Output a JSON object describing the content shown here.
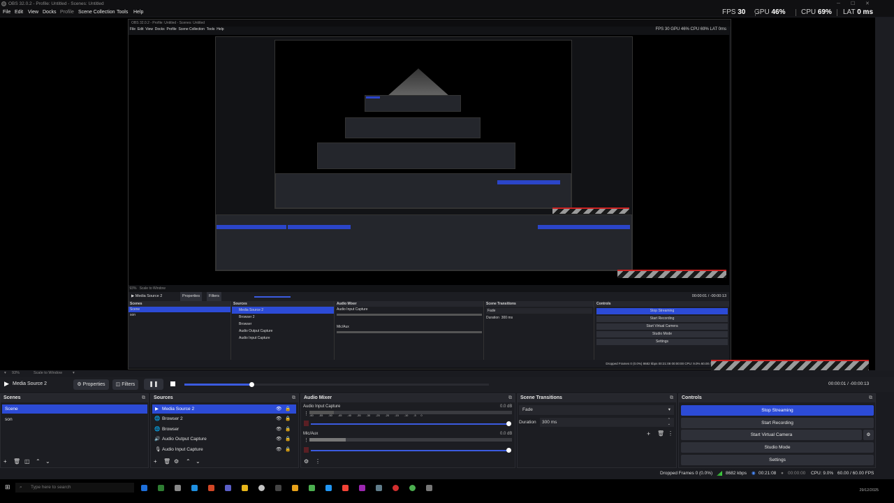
{
  "window": {
    "title": "OBS 32.0.2 - Profile: Untitled - Scenes: Untitled",
    "min": "─",
    "max": "☐",
    "close": "✕"
  },
  "menu": [
    "File",
    "Edit",
    "View",
    "Docks",
    "Profile",
    "Scene Collection",
    "Tools",
    "Help"
  ],
  "stats": {
    "fps_label": "FPS",
    "fps": "30",
    "gpu_label": "GPU",
    "gpu": "46",
    "cpu_label": "CPU",
    "cpu": "69",
    "lat_label": "LAT",
    "lat": "0",
    "pct": "%",
    "ms": "ms"
  },
  "nested": {
    "title": "OBS 32.0.2 - Profile: Untitled - Scenes: Untitled",
    "menu": [
      "File",
      "Edit",
      "View",
      "Docks",
      "Profile",
      "Scene Collection",
      "Tools",
      "Help"
    ],
    "stats": "FPS 30   GPU 46%   CPU 69%   LAT 0ms",
    "zoom": "93%",
    "scale": "Scale to Window",
    "media_source": "Media Source 2",
    "properties": "Properties",
    "filters": "Filters",
    "time": "00:00:01 / -00:00:13",
    "scenes_title": "Scenes",
    "sources_title": "Sources",
    "mixer_title": "Audio Mixer",
    "transitions_title": "Scene Transitions",
    "controls_title": "Controls",
    "scenes": [
      "Scene",
      "son"
    ],
    "sources": [
      "Media Source 2",
      "Browser 2",
      "Browser",
      "Audio Output Capture",
      "Audio Input Capture"
    ],
    "mixer": [
      "Audio Input Capture",
      "Mic/Aux"
    ],
    "db": "0.0 dB",
    "fade": "Fade",
    "duration_label": "Duration",
    "duration": "300 ms",
    "controls": [
      "Stop Streaming",
      "Start Recording",
      "Start Virtual Camera",
      "Studio Mode",
      "Settings"
    ],
    "status": "Dropped Frames 0 (0.0%)   8682 kbps   00:21:08   00:00:00   CPU: 9.0%   60.00 / 60.00 FPS"
  },
  "zoombar": {
    "zoom": "93%",
    "scale": "Scale to Window",
    "caret": "▾"
  },
  "media": {
    "name": "Media Source 2",
    "properties": "Properties",
    "filters": "Filters",
    "time_current": "00:00:01",
    "time_sep": "/",
    "time_remaining": "-00:00:13",
    "progress": 0.22
  },
  "scenes": {
    "title": "Scenes",
    "items": [
      "Scene",
      "son"
    ]
  },
  "sources": {
    "title": "Sources",
    "items": [
      {
        "name": "Media Source 2",
        "icon": "play-icon"
      },
      {
        "name": "Browser 2",
        "icon": "globe-icon"
      },
      {
        "name": "Browser",
        "icon": "globe-icon"
      },
      {
        "name": "Audio Output Capture",
        "icon": "speaker-icon"
      },
      {
        "name": "Audio Input Capture",
        "icon": "mic-icon"
      }
    ]
  },
  "mixer": {
    "title": "Audio Mixer",
    "channels": [
      {
        "name": "Audio Input Capture",
        "db": "0.0 dB",
        "level": 0.12
      },
      {
        "name": "Mic/Aux",
        "db": "0.0 dB",
        "level": 0.18
      }
    ],
    "scale": [
      "-60",
      "-55",
      "-50",
      "-45",
      "-40",
      "-35",
      "-30",
      "-25",
      "-20",
      "-15",
      "-10",
      "-5",
      "0"
    ]
  },
  "transitions": {
    "title": "Scene Transitions",
    "selected": "Fade",
    "duration_label": "Duration",
    "duration": "300 ms"
  },
  "controls": {
    "title": "Controls",
    "buttons": [
      "Stop Streaming",
      "Start Recording",
      "Start Virtual Camera",
      "Studio Mode",
      "Settings"
    ]
  },
  "status": {
    "dropped": "Dropped Frames 0 (0.0%)",
    "kbps": "8682 kbps",
    "live": "00:21:08",
    "rec": "00:00:00",
    "cpu": "CPU: 9.0%",
    "fps": "60.00 / 60.00 FPS"
  },
  "taskbar": {
    "search": "Type here to search",
    "time": "",
    "date": "29/12/2025"
  },
  "colors": {
    "accent": "#2c4bd6",
    "bg": "#1c1d22",
    "panel_header": "#26272d",
    "recording_red": "#cc2222"
  }
}
